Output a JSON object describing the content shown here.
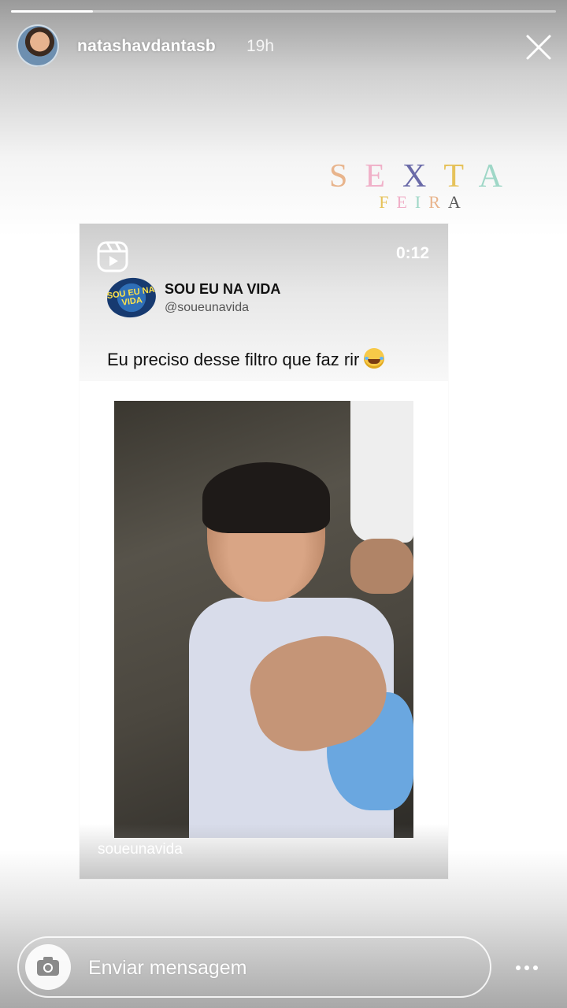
{
  "story": {
    "progress": 0.15,
    "username": "natashavdantasb",
    "time_ago": "19h"
  },
  "sticker": {
    "line1": [
      "S",
      "E",
      "X",
      "T",
      "A"
    ],
    "line2": [
      "F",
      "E",
      "I",
      "R",
      "A"
    ]
  },
  "shared_post": {
    "duration": "0:12",
    "account_name": "SOU EU NA VIDA",
    "account_handle": "@soueunavida",
    "logo_text": "SOU EU NA VIDA",
    "caption": "Eu preciso desse filtro que faz rir",
    "caption_emoji": "laughing-tears-emoji",
    "watermark": "soueunavida"
  },
  "reply_bar": {
    "placeholder": "Enviar mensagem"
  },
  "icons": {
    "close": "close-icon",
    "reels": "reels-icon",
    "camera": "camera-icon",
    "more": "more-options-icon"
  }
}
